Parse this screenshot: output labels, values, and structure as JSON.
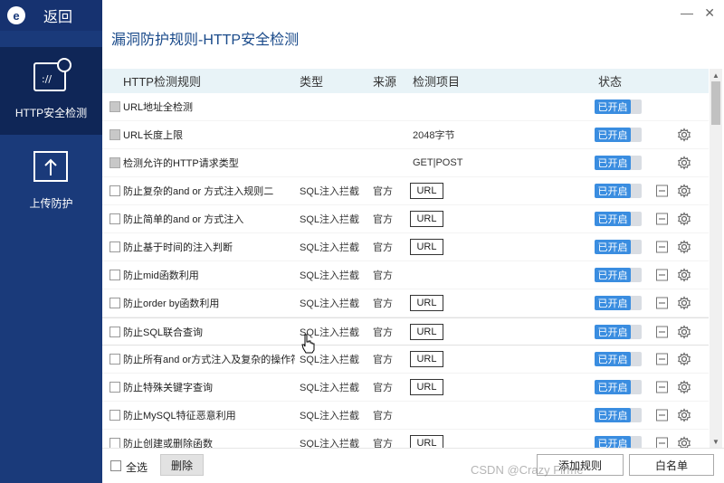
{
  "sidebar": {
    "logo_letter": "e",
    "back_label": "返回",
    "items": [
      {
        "label": "HTTP安全检测",
        "icon": "http-monitor-icon",
        "active": true
      },
      {
        "label": "上传防护",
        "icon": "upload-icon",
        "active": false
      }
    ]
  },
  "window": {
    "title": "漏洞防护规则-HTTP安全检测",
    "minimize_icon": "minimize-icon",
    "close_icon": "close-icon"
  },
  "table": {
    "headers": {
      "rule": "HTTP检测规则",
      "type": "类型",
      "source": "来源",
      "item": "检测项目",
      "status": "状态"
    },
    "rows": [
      {
        "name": "URL地址全检测",
        "type": "",
        "source": "",
        "item": "",
        "item_is_button": false,
        "status": "已开启",
        "disabled": true,
        "gear": false,
        "minus": false
      },
      {
        "name": "URL长度上限",
        "type": "",
        "source": "",
        "item": "2048字节",
        "item_is_button": false,
        "status": "已开启",
        "disabled": true,
        "gear": true,
        "minus": false
      },
      {
        "name": "检测允许的HTTP请求类型",
        "type": "",
        "source": "",
        "item": "GET|POST",
        "item_is_button": false,
        "status": "已开启",
        "disabled": true,
        "gear": true,
        "minus": false
      },
      {
        "name": "防止复杂的and or 方式注入规则二",
        "type": "SQL注入拦截",
        "source": "官方",
        "item": "URL",
        "item_is_button": true,
        "status": "已开启",
        "disabled": false,
        "gear": true,
        "minus": true
      },
      {
        "name": "防止简单的and or 方式注入",
        "type": "SQL注入拦截",
        "source": "官方",
        "item": "URL",
        "item_is_button": true,
        "status": "已开启",
        "disabled": false,
        "gear": true,
        "minus": true
      },
      {
        "name": "防止基于时间的注入判断",
        "type": "SQL注入拦截",
        "source": "官方",
        "item": "URL",
        "item_is_button": true,
        "status": "已开启",
        "disabled": false,
        "gear": true,
        "minus": true
      },
      {
        "name": "防止mid函数利用",
        "type": "SQL注入拦截",
        "source": "官方",
        "item": "",
        "item_is_button": false,
        "status": "已开启",
        "disabled": false,
        "gear": true,
        "minus": true
      },
      {
        "name": "防止order by函数利用",
        "type": "SQL注入拦截",
        "source": "官方",
        "item": "URL",
        "item_is_button": true,
        "status": "已开启",
        "disabled": false,
        "gear": true,
        "minus": true
      },
      {
        "name": "防止SQL联合查询",
        "type": "SQL注入拦截",
        "source": "官方",
        "item": "URL",
        "item_is_button": true,
        "status": "已开启",
        "disabled": false,
        "gear": true,
        "minus": true,
        "highlight": true
      },
      {
        "name": "防止所有and or方式注入及复杂的操作符...",
        "type": "SQL注入拦截",
        "source": "官方",
        "item": "URL",
        "item_is_button": true,
        "status": "已开启",
        "disabled": false,
        "gear": true,
        "minus": true
      },
      {
        "name": "防止特殊关键字查询",
        "type": "SQL注入拦截",
        "source": "官方",
        "item": "URL",
        "item_is_button": true,
        "status": "已开启",
        "disabled": false,
        "gear": true,
        "minus": true
      },
      {
        "name": "防止MySQL特征恶意利用",
        "type": "SQL注入拦截",
        "source": "官方",
        "item": "",
        "item_is_button": false,
        "status": "已开启",
        "disabled": false,
        "gear": true,
        "minus": true
      },
      {
        "name": "防止创建或删除函数",
        "type": "SQL注入拦截",
        "source": "官方",
        "item": "URL",
        "item_is_button": true,
        "status": "已开启",
        "disabled": false,
        "gear": true,
        "minus": true
      }
    ]
  },
  "footer": {
    "select_all": "全选",
    "delete": "删除",
    "add_rule": "添加规则",
    "whitelist": "白名单"
  },
  "watermark": "CSDN @Crazy Firme",
  "colors": {
    "sidebar": "#1a3a7a",
    "accent": "#3a8de0",
    "header_bg": "#e8f3f7"
  }
}
